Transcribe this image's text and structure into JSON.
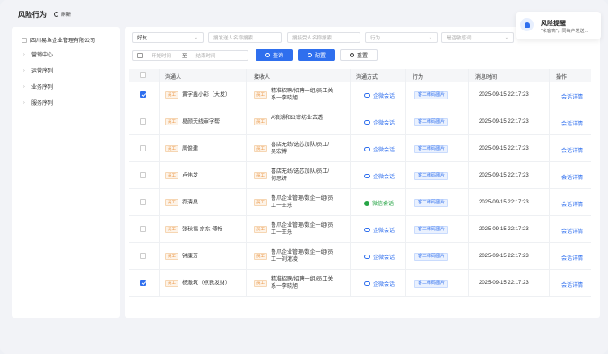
{
  "header": {
    "title": "风险行为",
    "refresh_label": "刷新"
  },
  "sidebar": {
    "root": "四川易鱼企业管理有限公司",
    "items": [
      {
        "label": "营销中心"
      },
      {
        "label": "运营序列"
      },
      {
        "label": "业务序列"
      },
      {
        "label": "服务序列"
      }
    ]
  },
  "filters": {
    "type_value": "好友",
    "reach_placeholder": "搜发送人名称搜索",
    "receiver_placeholder": "搜接受人名称搜索",
    "behavior_placeholder": "行为",
    "source_placeholder": "是否敏感词",
    "start_placeholder": "开始时间",
    "date_sep": "至",
    "end_placeholder": "结束时间",
    "search_label": "查询",
    "config_label": "配置",
    "reset_label": "重置"
  },
  "table": {
    "headers": [
      "沟通人",
      "接收人",
      "沟通方式",
      "行为",
      "消息时间",
      "操作"
    ],
    "emp_tag": "员工",
    "rows": [
      {
        "checked": true,
        "sender": "黄字鑫小彩（大发）",
        "receiver": "精准招聘/招聘一组/员工关系一李晓旭",
        "channel": "企微会话",
        "channel_type": "qw",
        "action": "客二维码图片",
        "time": "2025-09-15 22:17:23",
        "op": "会话详情"
      },
      {
        "checked": false,
        "sender": "易颜天线审字帮",
        "receiver": "A浪潮和公审坊业去透",
        "channel": "企微会话",
        "channel_type": "qw",
        "action": "客二维码图片",
        "time": "2025-09-15 22:17:23",
        "op": "会话详情"
      },
      {
        "checked": false,
        "sender": "周俊建",
        "receiver": "喜店无线/选芯加队/员工/吴宏博",
        "channel": "企微会话",
        "channel_type": "qw",
        "action": "客二维码图片",
        "time": "2025-09-15 22:17:23",
        "op": "会话详情"
      },
      {
        "checked": false,
        "sender": "卢伟发",
        "receiver": "喜店无线/选芯加队/员工/何思妍",
        "channel": "企微会话",
        "channel_type": "qw",
        "action": "客二维码图片",
        "time": "2025-09-15 22:17:23",
        "op": "会话详情"
      },
      {
        "checked": false,
        "sender": "乔清泉",
        "receiver": "鲁爪企业管理/数企一组/员工一王乐",
        "channel": "微信会话",
        "channel_type": "wx",
        "action": "客二维码图片",
        "time": "2025-09-15 22:17:23",
        "op": "会话详情"
      },
      {
        "checked": false,
        "sender": "张秋福 京东 傅畅",
        "receiver": "鲁爪企业管理/数企一组/员工一王乐",
        "channel": "企微会话",
        "channel_type": "qw",
        "action": "客二维码图片",
        "time": "2025-09-15 22:17:23",
        "op": "会话详情"
      },
      {
        "checked": false,
        "sender": "钟康芳",
        "receiver": "鲁爪企业管理/数企一组/员工一刘灌凌",
        "channel": "企微会话",
        "channel_type": "qw",
        "action": "客二维码图片",
        "time": "2025-09-15 22:17:23",
        "op": "会话详情"
      },
      {
        "checked": true,
        "sender": "杨澈筑（点我发财）",
        "receiver": "精准招聘/招聘一组/员工关系一李晓旭",
        "channel": "企微会话",
        "channel_type": "qw",
        "action": "客二维码图片",
        "time": "2025-09-15 22:17:23",
        "op": "会话详情"
      }
    ]
  },
  "notification": {
    "title": "风险提醒",
    "text": "\"米客高\"，同每户发送…"
  },
  "colors": {
    "primary": "#2f6fee",
    "emp_tag": "#e9903a",
    "wechat": "#27a546"
  }
}
